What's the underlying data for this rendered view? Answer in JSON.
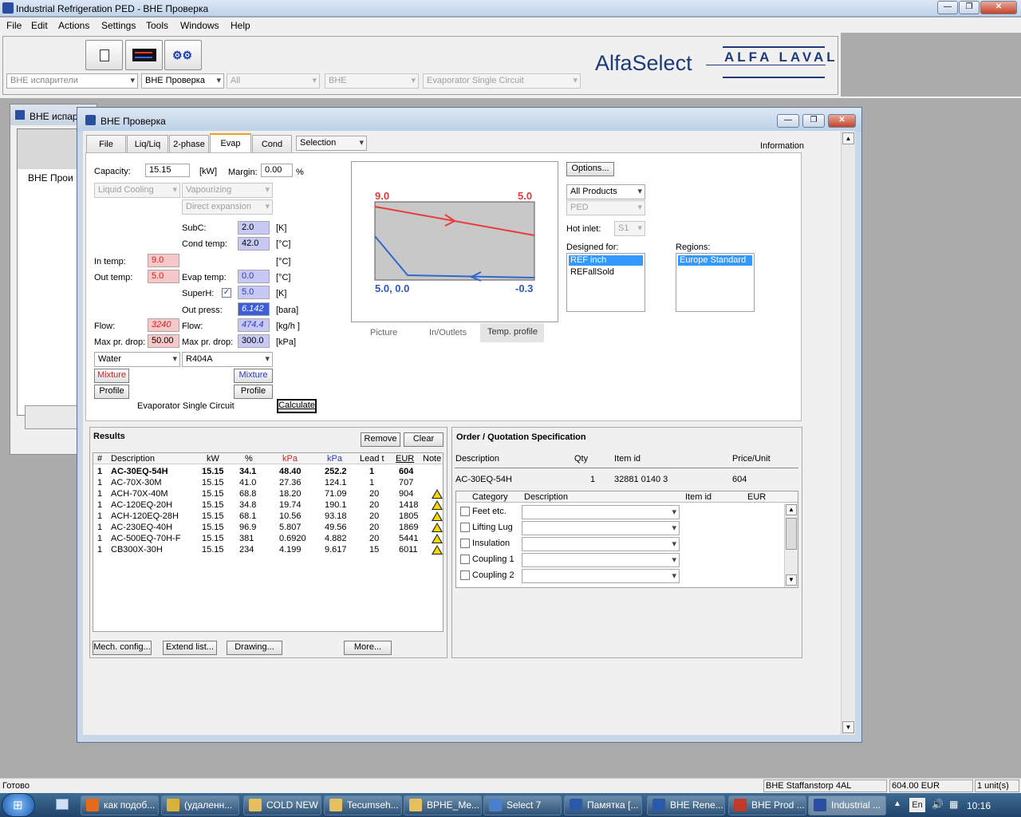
{
  "app": {
    "title": "Industrial Refrigeration PED - BHE Проверка",
    "minimize": "—",
    "restore": "❐",
    "close": "✕"
  },
  "menu": [
    "File",
    "Edit",
    "Actions",
    "Settings",
    "Tools",
    "Windows",
    "Help"
  ],
  "toolbar": {
    "combos": [
      "BHE испарители",
      "BHE Проверка",
      "All",
      "BHE",
      "Evaporator Single Circuit"
    ],
    "brand": "AlfaSelect",
    "logo_text": "ALFA LAVAL"
  },
  "bg_window": {
    "title": "BHE испар",
    "cell": "BHE Прои"
  },
  "child": {
    "title": "BHE Проверка",
    "tabs": [
      "File",
      "Liq/Liq",
      "2-phase",
      "Evap",
      "Cond"
    ],
    "active_tab": "Evap",
    "selection_combo": "Selection",
    "information": "Information"
  },
  "form": {
    "capacity_label": "Capacity:",
    "capacity": "15.15",
    "capacity_unit": "[kW]",
    "margin_label": "Margin:",
    "margin": "0.00",
    "margin_unit": "%",
    "hot_mode": "Liquid Cooling",
    "cold_mode": "Vapourizing",
    "cold_mode2": "Direct expansion",
    "subc_label": "SubC:",
    "subc": "2.0",
    "subc_unit": "[K]",
    "cond_temp_label": "Cond temp:",
    "cond_temp": "42.0",
    "cond_temp_unit": "[°C]",
    "in_temp_label": "In temp:",
    "in_temp": "9.0",
    "in_temp_unit": "[°C]",
    "out_temp_label": "Out temp:",
    "out_temp": "5.0",
    "evap_temp_label": "Evap temp:",
    "evap_temp": "0.0",
    "evap_temp_unit": "[°C]",
    "superh_label": "SuperH:",
    "superh_check": "✓",
    "superh": "5.0",
    "superh_unit": "[K]",
    "out_press_label": "Out press:",
    "out_press": "6.142",
    "out_press_unit": "[bara]",
    "flow_label": "Flow:",
    "flow_hot": "3240",
    "flow_cold_label": "Flow:",
    "flow_cold": "474.4",
    "flow_unit": "[kg/h ]",
    "maxpd_label": "Max pr. drop:",
    "maxpd_hot": "50.00",
    "maxpd_cold_label": "Max pr. drop:",
    "maxpd_cold": "300.0",
    "maxpd_unit": "[kPa]",
    "fluid_hot": "Water",
    "fluid_cold": "R404A",
    "mixture": "Mixture",
    "profile": "Profile",
    "circuit": "Evaporator Single Circuit",
    "calculate": "Calculate"
  },
  "profile_chart": {
    "hot_in": "9.0",
    "hot_out": "5.0",
    "cold_left": "5.0,  0.0",
    "cold_right": "-0.3",
    "tabs": [
      "Picture",
      "In/Outlets",
      "Temp. profile"
    ],
    "active_tab": "Temp. profile"
  },
  "options": {
    "options_btn": "Options...",
    "products": "All Products",
    "ped": "PED",
    "hot_inlet_label": "Hot inlet:",
    "hot_inlet": "S1",
    "designed_for_label": "Designed for:",
    "designed_for": [
      "REF inch",
      "REFallSold"
    ],
    "regions_label": "Regions:",
    "regions": [
      "Europe Standard"
    ]
  },
  "results": {
    "title": "Results",
    "remove": "Remove",
    "clear": "Clear",
    "columns": [
      "#",
      "Description",
      "kW",
      "%",
      "kPa",
      "kPa",
      "Lead t",
      "EUR",
      "Note"
    ],
    "rows": [
      {
        "n": "1",
        "desc": "AC-30EQ-54H",
        "kw": "15.15",
        "pct": "34.1",
        "kpa1": "48.40",
        "kpa2": "252.2",
        "lead": "1",
        "eur": "604",
        "warn": false,
        "bold": true
      },
      {
        "n": "1",
        "desc": "AC-70X-30M",
        "kw": "15.15",
        "pct": "41.0",
        "kpa1": "27.36",
        "kpa2": "124.1",
        "lead": "1",
        "eur": "707",
        "warn": false,
        "bold": false
      },
      {
        "n": "1",
        "desc": "ACH-70X-40M",
        "kw": "15.15",
        "pct": "68.8",
        "kpa1": "18.20",
        "kpa2": "71.09",
        "lead": "20",
        "eur": "904",
        "warn": true,
        "bold": false
      },
      {
        "n": "1",
        "desc": "AC-120EQ-20H",
        "kw": "15.15",
        "pct": "34.8",
        "kpa1": "19.74",
        "kpa2": "190.1",
        "lead": "20",
        "eur": "1418",
        "warn": true,
        "bold": false
      },
      {
        "n": "1",
        "desc": "ACH-120EQ-28H",
        "kw": "15.15",
        "pct": "68.1",
        "kpa1": "10.56",
        "kpa2": "93.18",
        "lead": "20",
        "eur": "1805",
        "warn": true,
        "bold": false
      },
      {
        "n": "1",
        "desc": "AC-230EQ-40H",
        "kw": "15.15",
        "pct": "96.9",
        "kpa1": "5.807",
        "kpa2": "49.56",
        "lead": "20",
        "eur": "1869",
        "warn": true,
        "bold": false
      },
      {
        "n": "1",
        "desc": "AC-500EQ-70H-F",
        "kw": "15.15",
        "pct": "381",
        "kpa1": "0.6920",
        "kpa2": "4.882",
        "lead": "20",
        "eur": "5441",
        "warn": true,
        "bold": false
      },
      {
        "n": "1",
        "desc": "CB300X-30H",
        "kw": "15.15",
        "pct": "234",
        "kpa1": "4.199",
        "kpa2": "9.617",
        "lead": "15",
        "eur": "6011",
        "warn": true,
        "bold": false
      }
    ],
    "buttons": [
      "Mech. config...",
      "Extend list...",
      "Drawing...",
      "More..."
    ]
  },
  "order": {
    "title": "Order / Quotation Specification",
    "columns": [
      "Description",
      "Qty",
      "Item id",
      "Price/Unit"
    ],
    "row": {
      "desc": "AC-30EQ-54H",
      "qty": "1",
      "item": "32881 0140 3",
      "price": "604"
    },
    "acc_columns": [
      "Category",
      "Description",
      "Item id",
      "EUR"
    ],
    "accessories": [
      "Feet etc.",
      "Lifting Lug",
      "Insulation",
      "Coupling 1",
      "Coupling 2"
    ]
  },
  "status": {
    "ready": "Готово",
    "company": "BHE Staffanstorp 4AL",
    "price": "604.00 EUR",
    "units": "1 unit(s)"
  },
  "taskbar": {
    "items": [
      "как подоб...",
      "(удаленн...",
      "COLD NEW",
      "Tecumseh...",
      "BPHE_Me...",
      "Select 7",
      "Памятка [...",
      "BHE Rene...",
      "BHE Prod ...",
      "Industrial ..."
    ],
    "lang": "En",
    "clock": "10:16"
  }
}
